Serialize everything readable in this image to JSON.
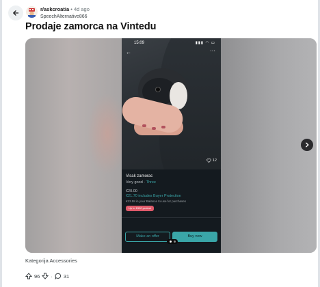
{
  "post": {
    "subreddit": "r/askcroatia",
    "separator": "•",
    "age": "4d ago",
    "author": "SpeechAlternative866",
    "title": "Prodaje zamorca na Vintedu",
    "caption": "Kategorija Accessories"
  },
  "media": {
    "status_time": "15:09",
    "status_icons": "▮▮▮ ◠ ▭",
    "back_glyph": "←",
    "more_glyph": "⋯",
    "likes": "12",
    "item_title": "Visak zamorac",
    "condition_label": "Very good",
    "condition_link": "Three",
    "price_base": "€20.00",
    "price_protection": "€21.70 includes Buyer Protection",
    "balance_note": "€23.58 in your Balance to use for purchases",
    "badge": "Up to 1500 protect",
    "make_offer": "Make an offer",
    "buy_now": "Buy now"
  },
  "actions": {
    "upvotes": "96",
    "dot": "·",
    "comments": "31"
  },
  "icons": {
    "back": "arrow-left-icon",
    "next": "chevron-right-icon",
    "upvote": "arrow-up-icon",
    "downvote": "arrow-down-icon",
    "comment": "speech-bubble-icon",
    "heart": "heart-icon"
  },
  "colors": {
    "vinted_teal": "#3aa6a8",
    "badge_pink": "#e05a6a",
    "title_text": "#111111"
  }
}
